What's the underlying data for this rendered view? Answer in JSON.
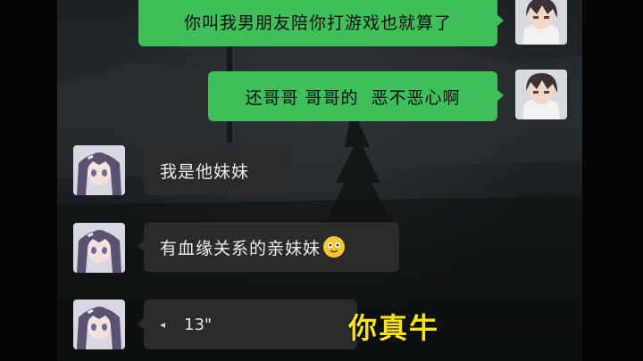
{
  "messages": [
    {
      "side": "right",
      "text": "你叫我男朋友陪你打游戏也就算了"
    },
    {
      "side": "right",
      "text": "还哥哥 哥哥的  恶不恶心啊"
    },
    {
      "side": "left",
      "text": "我是他妹妹"
    },
    {
      "side": "left",
      "text": "有血缘关系的亲妹妹",
      "emoji": "flushed-smile-emoji"
    },
    {
      "side": "left",
      "type": "voice",
      "duration": "13\""
    }
  ],
  "caption": "你真牛",
  "colors": {
    "outgoing_bubble": "#3fbf5a",
    "incoming_bubble": "#2b2b2c",
    "caption": "#ffe600"
  },
  "icons": {
    "voice": "voice-wave-icon",
    "avatar_right": "boy-avatar",
    "avatar_left": "girl-avatar"
  }
}
